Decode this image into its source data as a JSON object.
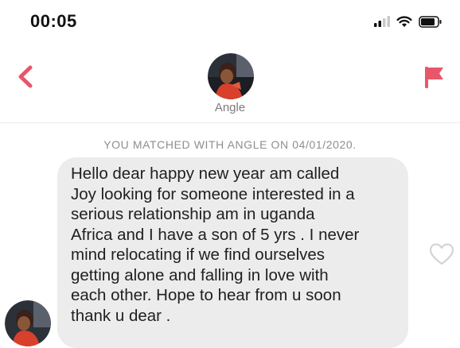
{
  "status_bar": {
    "time": "00:05",
    "icons": [
      "cellular-signal-icon",
      "wifi-icon",
      "battery-icon"
    ]
  },
  "header": {
    "back_icon": "chevron-left-icon",
    "report_icon": "flag-icon",
    "contact_name": "Angle",
    "accent_color": "#e8566b"
  },
  "conversation": {
    "match_banner": "YOU MATCHED WITH ANGLE ON 04/01/2020.",
    "messages": [
      {
        "sender": "Angle",
        "lines": [
          "Hello dear happy new year am called",
          "Joy looking for someone interested in a",
          "serious relationship am in uganda",
          "Africa and I have a son of 5 yrs . I never",
          "mind relocating if we find ourselves",
          "getting alone and falling in love with",
          "each other. Hope to hear from u soon",
          "thank u dear ."
        ],
        "like_icon": "heart-outline-icon",
        "bubble_color": "#ececec"
      }
    ]
  }
}
